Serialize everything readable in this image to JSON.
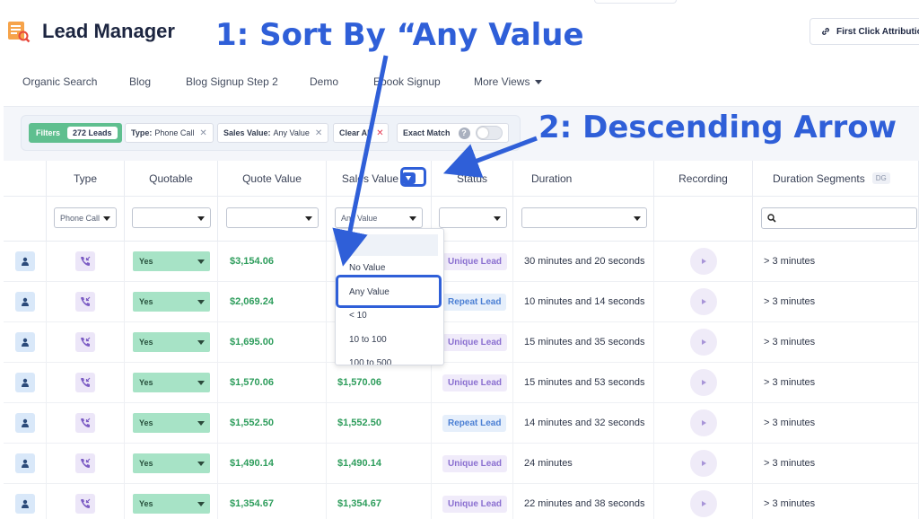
{
  "app": {
    "title": "Lead Manager",
    "attribution_button": "First Click Attribution"
  },
  "tabs": [
    {
      "label": "Organic Search"
    },
    {
      "label": "Blog"
    },
    {
      "label": "Blog Signup Step 2"
    },
    {
      "label": "Demo"
    },
    {
      "label": "Ebook Signup"
    },
    {
      "label": "More Views"
    }
  ],
  "filters": {
    "label": "Filters",
    "count": "272 Leads",
    "type_key": "Type:",
    "type_value": "Phone Call",
    "sales_key": "Sales Value:",
    "sales_value": "Any Value",
    "clear_all": "Clear All",
    "exact_match": "Exact Match",
    "help_glyph": "?",
    "close_glyph": "✕"
  },
  "table": {
    "headers": {
      "type": "Type",
      "quotable": "Quotable",
      "quote_value": "Quote Value",
      "sales_value": "Sales Value",
      "status": "Status",
      "duration": "Duration",
      "recording": "Recording",
      "duration_segments": "Duration Segments",
      "dg_badge": "DG"
    },
    "filter_row": {
      "type_select": "Phone Call",
      "sales_select": "Any Value"
    },
    "rows": [
      {
        "quotable": "Yes",
        "quote_value": "$3,154.06",
        "sales_value": "",
        "status": "Unique Lead",
        "status_kind": "unique",
        "duration": "30 minutes and 20 seconds",
        "segment": "> 3 minutes"
      },
      {
        "quotable": "Yes",
        "quote_value": "$2,069.24",
        "sales_value": "",
        "status": "Repeat Lead",
        "status_kind": "repeat",
        "duration": "10 minutes and 14 seconds",
        "segment": "> 3 minutes"
      },
      {
        "quotable": "Yes",
        "quote_value": "$1,695.00",
        "sales_value": "",
        "status": "Unique Lead",
        "status_kind": "unique",
        "duration": "15 minutes and 35 seconds",
        "segment": "> 3 minutes"
      },
      {
        "quotable": "Yes",
        "quote_value": "$1,570.06",
        "sales_value": "$1,570.06",
        "status": "Unique Lead",
        "status_kind": "unique",
        "duration": "15 minutes and 53 seconds",
        "segment": "> 3 minutes"
      },
      {
        "quotable": "Yes",
        "quote_value": "$1,552.50",
        "sales_value": "$1,552.50",
        "status": "Repeat Lead",
        "status_kind": "repeat",
        "duration": "14 minutes and 32 seconds",
        "segment": "> 3 minutes"
      },
      {
        "quotable": "Yes",
        "quote_value": "$1,490.14",
        "sales_value": "$1,490.14",
        "status": "Unique Lead",
        "status_kind": "unique",
        "duration": "24 minutes",
        "segment": "> 3 minutes"
      },
      {
        "quotable": "Yes",
        "quote_value": "$1,354.67",
        "sales_value": "$1,354.67",
        "status": "Unique Lead",
        "status_kind": "unique",
        "duration": "22 minutes and 38 seconds",
        "segment": "> 3 minutes"
      }
    ]
  },
  "sales_dropdown": {
    "options": [
      "No Value",
      "Any Value",
      "< 10",
      "10 to 100",
      "100 to 500"
    ]
  },
  "annotations": {
    "step1": "1: Sort By “Any Value",
    "step2": "2: Descending Arrow"
  },
  "colors": {
    "accent": "#2f5fd8",
    "money": "#2e9d5c",
    "filters_green": "#5fbf8f",
    "yes_green": "#a7e3c6"
  },
  "icons": [
    "lead-manager-logo-icon",
    "link-icon",
    "person-icon",
    "incoming-call-icon",
    "play-icon",
    "search-icon",
    "chevron-down-icon"
  ]
}
